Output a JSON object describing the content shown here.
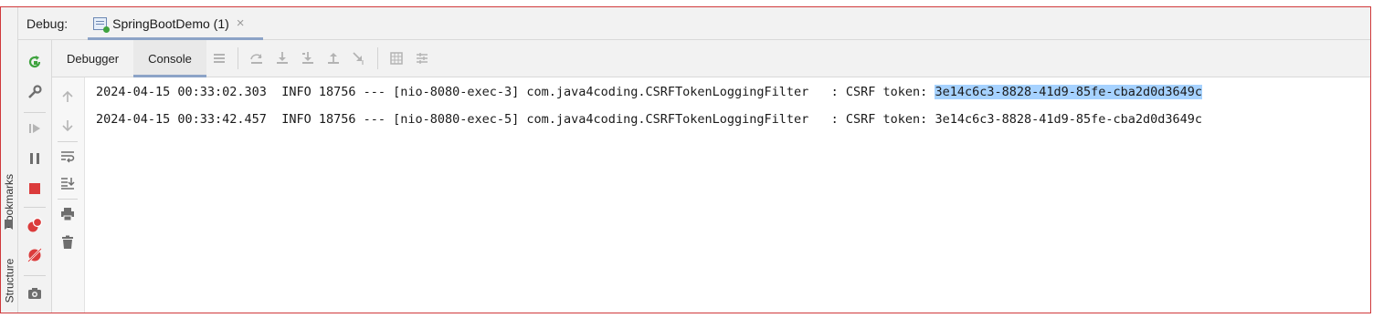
{
  "sidebar_tabs": {
    "bookmarks": "Bookmarks",
    "structure": "Structure"
  },
  "debug_panel": {
    "label": "Debug:",
    "run_tab": {
      "title": "SpringBootDemo (1)",
      "close_glyph": "×"
    }
  },
  "subtabs": [
    {
      "label": "Debugger",
      "active": false
    },
    {
      "label": "Console",
      "active": true
    }
  ],
  "toolbar_icons": [
    "thread-dump-icon",
    "step-over-icon",
    "step-into-icon",
    "force-step-into-icon",
    "step-out-icon",
    "run-to-cursor-icon",
    "evaluate-expression-icon",
    "trace-current-stream-icon"
  ],
  "action_icons": [
    "rerun-icon",
    "modify-run-config-icon",
    "resume-icon",
    "pause-icon",
    "stop-icon",
    "view-breakpoints-icon",
    "mute-breakpoints-icon",
    "camera-icon"
  ],
  "gutter_icons": [
    "up-arrow-icon",
    "down-arrow-icon",
    "soft-wrap-icon",
    "scroll-to-end-icon",
    "print-icon",
    "clear-icon"
  ],
  "console": {
    "lines": [
      {
        "prefix": "2024-04-15 00:33:02.303  INFO 18756 --- [nio-8080-exec-3] com.java4coding.CSRFTokenLoggingFilter   : CSRF token: ",
        "token": "3e14c6c3-8828-41d9-85fe-cba2d0d3649c",
        "selected": true
      },
      {
        "prefix": "2024-04-15 00:33:42.457  INFO 18756 --- [nio-8080-exec-5] com.java4coding.CSRFTokenLoggingFilter   : CSRF token: ",
        "token": "3e14c6c3-8828-41d9-85fe-cba2d0d3649c",
        "selected": false
      }
    ]
  },
  "colors": {
    "frame_border": "#d0393b",
    "selection": "#a6d2ff",
    "rerun_green": "#3fa33f",
    "stop_red": "#db3b3b",
    "tab_underline": "#8ca3c7"
  }
}
